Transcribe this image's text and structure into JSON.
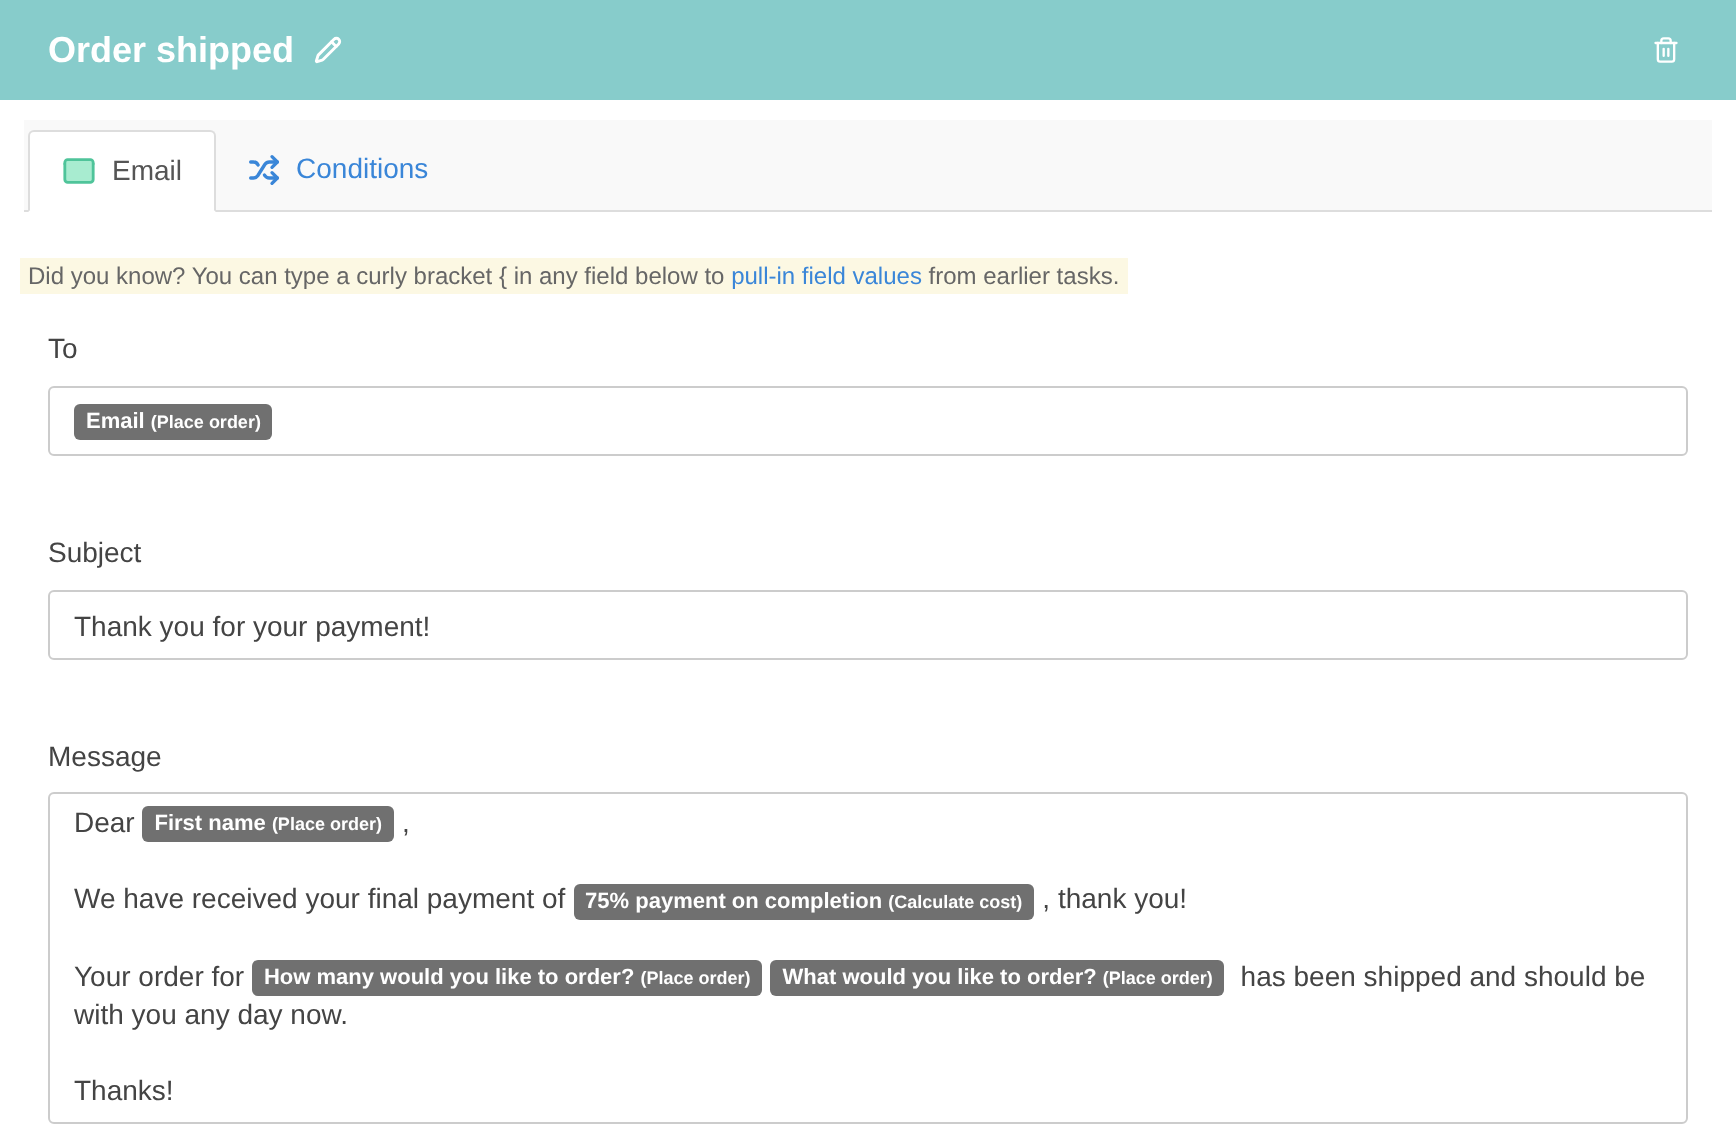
{
  "header": {
    "title": "Order shipped"
  },
  "tabs": [
    {
      "label": "Email",
      "kind": "email",
      "selected": true
    },
    {
      "label": "Conditions",
      "kind": "conditions",
      "selected": false
    }
  ],
  "hint": {
    "before": "Did you know? You can type a curly bracket { in any field below to",
    "link": "pull-in field values",
    "after": "from earlier tasks."
  },
  "to": {
    "label": "To",
    "tokens": [
      {
        "name": "Email",
        "source": "(Place order)"
      }
    ]
  },
  "subject": {
    "label": "Subject",
    "value": "Thank you for your payment!"
  },
  "message": {
    "label": "Message",
    "paragraphs": [
      [
        {
          "kind": "text",
          "text": "Dear "
        },
        {
          "kind": "token",
          "name": "First name",
          "source": "(Place order)"
        },
        {
          "kind": "text",
          "text": ","
        }
      ],
      [
        {
          "kind": "text",
          "text": "We have received your final payment of "
        },
        {
          "kind": "token",
          "name": "75% payment on completion",
          "source": "(Calculate cost)"
        },
        {
          "kind": "text",
          "text": ", thank you!"
        }
      ],
      [
        {
          "kind": "text",
          "text": "Your order for "
        },
        {
          "kind": "token",
          "name": "How many would you like to order?",
          "source": "(Place order)"
        },
        {
          "kind": "token",
          "name": "What would you like to order?",
          "source": "(Place order)"
        },
        {
          "kind": "text",
          "text": " has been shipped and should be with you any day now."
        }
      ],
      [
        {
          "kind": "text",
          "text": "Thanks!"
        }
      ]
    ]
  }
}
